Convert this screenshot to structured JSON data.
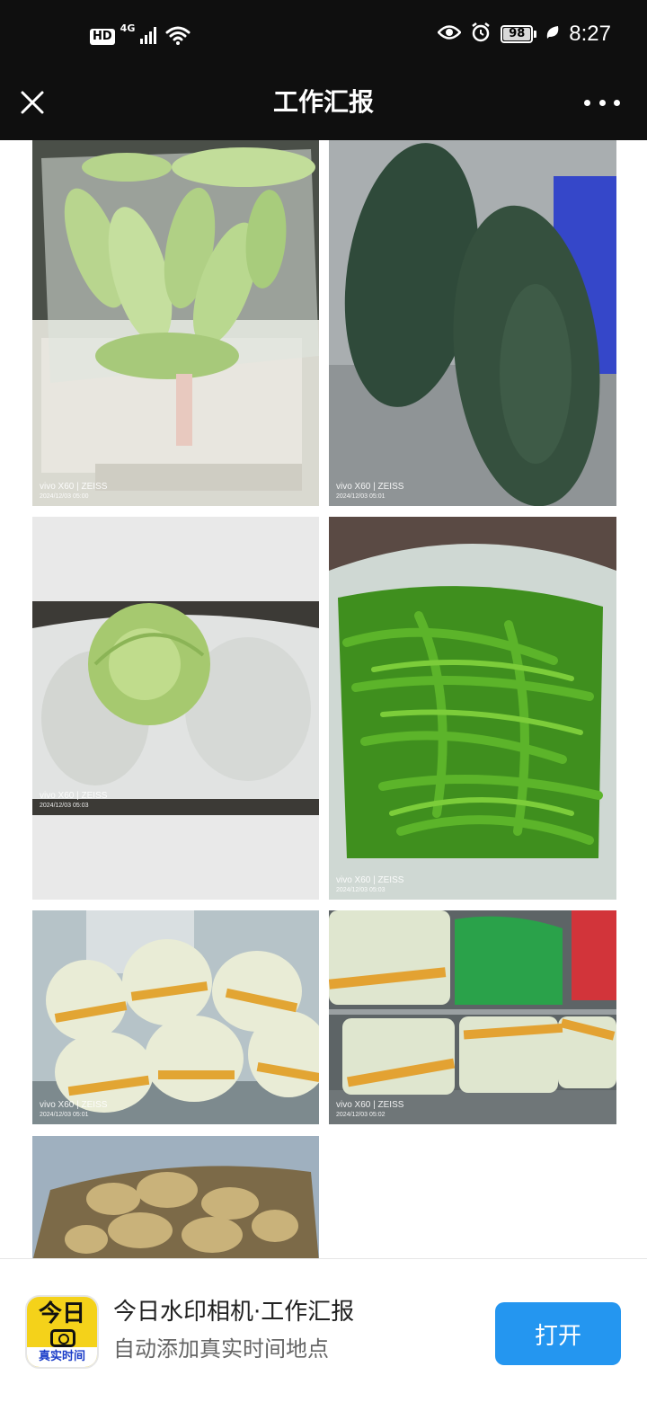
{
  "status_bar": {
    "hd": "HD",
    "network": "4G",
    "battery": "98",
    "time": "8:27"
  },
  "nav": {
    "title": "工作汇报"
  },
  "photos": [
    {
      "brand": "vivo X60 | ZEISS",
      "date": "2024/12/03 05:00"
    },
    {
      "brand": "vivo X60 | ZEISS",
      "date": "2024/12/03 05:01"
    },
    {
      "brand": "vivo X60 | ZEISS",
      "date": "2024/12/03 05:03"
    },
    {
      "brand": "vivo X60 | ZEISS",
      "date": "2024/12/03 05:03"
    },
    {
      "brand": "vivo X60 | ZEISS",
      "date": "2024/12/03 05:01"
    },
    {
      "brand": "vivo X60 | ZEISS",
      "date": "2024/12/03 05:02"
    },
    {
      "brand": "",
      "date": ""
    }
  ],
  "banner": {
    "icon_text": "今日",
    "icon_sub": "真实时间",
    "title": "今日水印相机·工作汇报",
    "subtitle": "自动添加真实时间地点",
    "open_label": "打开"
  },
  "colors": {
    "bar_background": "#0f0f0f",
    "open_button": "#2496f0",
    "icon_yellow": "#f4d21a"
  }
}
